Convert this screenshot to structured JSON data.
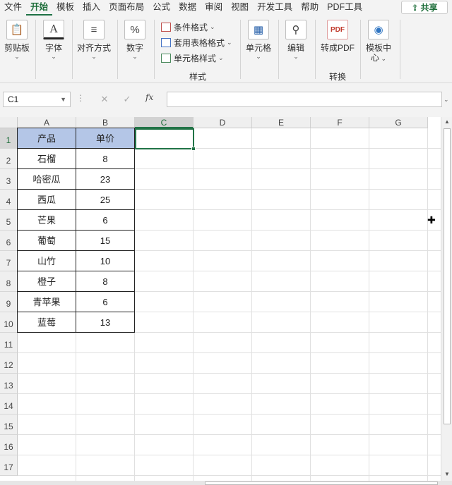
{
  "menu": {
    "tabs": [
      "文件",
      "开始",
      "模板",
      "插入",
      "页面布局",
      "公式",
      "数据",
      "审阅",
      "视图",
      "开发工具",
      "帮助",
      "PDF工具"
    ],
    "active_tab": "开始",
    "share_label": "共享"
  },
  "ribbon": {
    "clipboard_label": "剪贴板",
    "font_label": "字体",
    "align_label": "对齐方式",
    "number_label": "数字",
    "conditional_format_label": "条件格式",
    "table_format_label": "套用表格格式",
    "cell_style_label": "单元格样式",
    "styles_group_label": "样式",
    "cells_label": "单元格",
    "edit_label": "编辑",
    "to_pdf_label": "转成PDF",
    "convert_group_label": "转换",
    "template_center_label": "模板中心",
    "template_center_line1": "模板中",
    "template_center_line2": "心"
  },
  "formula_bar": {
    "name_box": "C1",
    "fx_label": "fx",
    "formula": ""
  },
  "sheet": {
    "columns": [
      "A",
      "B",
      "C",
      "D",
      "E",
      "F",
      "G"
    ],
    "selected_column": "C",
    "rows": [
      "1",
      "2",
      "3",
      "4",
      "5",
      "6",
      "7",
      "8",
      "9",
      "10",
      "11",
      "12",
      "13",
      "14",
      "15",
      "16",
      "17"
    ],
    "selected_row": "1",
    "table": {
      "headers": [
        "产品",
        "单价"
      ],
      "data": [
        [
          "石榴",
          "8"
        ],
        [
          "哈密瓜",
          "23"
        ],
        [
          "西瓜",
          "25"
        ],
        [
          "芒果",
          "6"
        ],
        [
          "葡萄",
          "15"
        ],
        [
          "山竹",
          "10"
        ],
        [
          "橙子",
          "8"
        ],
        [
          "青苹果",
          "6"
        ],
        [
          "蓝莓",
          "13"
        ]
      ]
    },
    "header_fill_color": "#b4c6e7",
    "accent_color": "#217346"
  }
}
